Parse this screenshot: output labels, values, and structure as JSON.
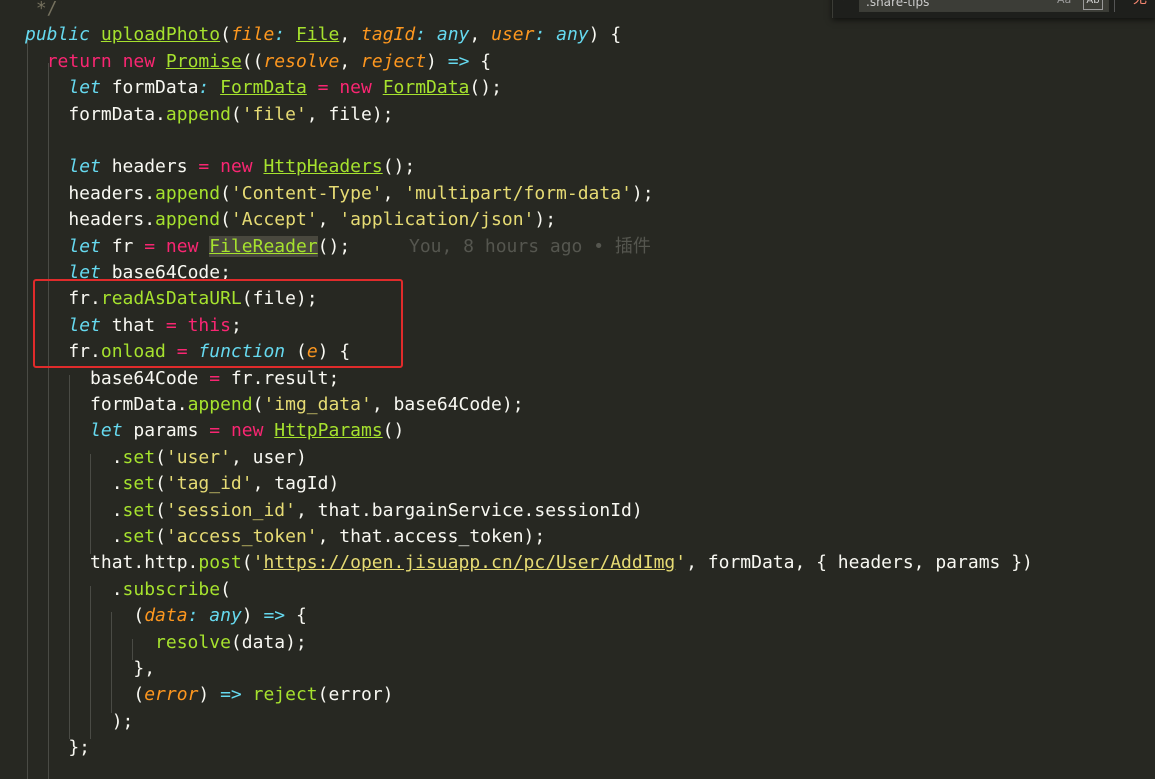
{
  "editor": {
    "lines": [
      [
        {
          "t": "t-comment",
          "v": " */"
        }
      ],
      [
        {
          "t": "t-storage",
          "v": "public",
          "raw": true
        },
        {
          "t": "t-plain",
          "v": " "
        },
        {
          "t": "t-fn-u",
          "v": "uploadPhoto"
        },
        {
          "t": "t-plain",
          "v": "("
        },
        {
          "t": "t-param",
          "v": "file"
        },
        {
          "t": "t-any",
          "v": ":"
        },
        {
          "t": "t-plain",
          "v": " "
        },
        {
          "t": "t-type",
          "v": "File"
        },
        {
          "t": "t-plain",
          "v": ", "
        },
        {
          "t": "t-param",
          "v": "tagId"
        },
        {
          "t": "t-any",
          "v": ":"
        },
        {
          "t": "t-plain",
          "v": " "
        },
        {
          "t": "t-any",
          "v": "any"
        },
        {
          "t": "t-plain",
          "v": ", "
        },
        {
          "t": "t-param",
          "v": "user"
        },
        {
          "t": "t-any",
          "v": ":"
        },
        {
          "t": "t-plain",
          "v": " "
        },
        {
          "t": "t-any",
          "v": "any"
        },
        {
          "t": "t-plain",
          "v": ") {"
        }
      ],
      [
        {
          "t": "t-plain",
          "v": "  "
        },
        {
          "t": "t-kw",
          "v": "return"
        },
        {
          "t": "t-plain",
          "v": " "
        },
        {
          "t": "t-kw",
          "v": "new"
        },
        {
          "t": "t-plain",
          "v": " "
        },
        {
          "t": "t-type",
          "v": "Promise"
        },
        {
          "t": "t-plain",
          "v": "(("
        },
        {
          "t": "t-param",
          "v": "resolve"
        },
        {
          "t": "t-plain",
          "v": ", "
        },
        {
          "t": "t-param",
          "v": "reject"
        },
        {
          "t": "t-plain",
          "v": ") "
        },
        {
          "t": "t-arrow",
          "v": "=>"
        },
        {
          "t": "t-plain",
          "v": " {"
        }
      ],
      [
        {
          "t": "t-plain",
          "v": "    "
        },
        {
          "t": "t-storage",
          "v": "let"
        },
        {
          "t": "t-plain",
          "v": " formData"
        },
        {
          "t": "t-any",
          "v": ":"
        },
        {
          "t": "t-plain",
          "v": " "
        },
        {
          "t": "t-type",
          "v": "FormData"
        },
        {
          "t": "t-plain",
          "v": " "
        },
        {
          "t": "t-op",
          "v": "="
        },
        {
          "t": "t-plain",
          "v": " "
        },
        {
          "t": "t-kw",
          "v": "new"
        },
        {
          "t": "t-plain",
          "v": " "
        },
        {
          "t": "t-type",
          "v": "FormData"
        },
        {
          "t": "t-plain",
          "v": "();"
        }
      ],
      [
        {
          "t": "t-plain",
          "v": "    formData."
        },
        {
          "t": "t-fn",
          "v": "append"
        },
        {
          "t": "t-plain",
          "v": "("
        },
        {
          "t": "t-str",
          "v": "'file'"
        },
        {
          "t": "t-plain",
          "v": ", file);"
        }
      ],
      [
        {
          "t": "t-plain",
          "v": ""
        }
      ],
      [
        {
          "t": "t-plain",
          "v": "    "
        },
        {
          "t": "t-storage",
          "v": "let"
        },
        {
          "t": "t-plain",
          "v": " headers "
        },
        {
          "t": "t-op",
          "v": "="
        },
        {
          "t": "t-plain",
          "v": " "
        },
        {
          "t": "t-kw",
          "v": "new"
        },
        {
          "t": "t-plain",
          "v": " "
        },
        {
          "t": "t-type",
          "v": "HttpHeaders"
        },
        {
          "t": "t-plain",
          "v": "();"
        }
      ],
      [
        {
          "t": "t-plain",
          "v": "    headers."
        },
        {
          "t": "t-fn",
          "v": "append"
        },
        {
          "t": "t-plain",
          "v": "("
        },
        {
          "t": "t-str",
          "v": "'Content-Type'"
        },
        {
          "t": "t-plain",
          "v": ", "
        },
        {
          "t": "t-str",
          "v": "'multipart/form-data'"
        },
        {
          "t": "t-plain",
          "v": ");"
        }
      ],
      [
        {
          "t": "t-plain",
          "v": "    headers."
        },
        {
          "t": "t-fn",
          "v": "append"
        },
        {
          "t": "t-plain",
          "v": "("
        },
        {
          "t": "t-str",
          "v": "'Accept'"
        },
        {
          "t": "t-plain",
          "v": ", "
        },
        {
          "t": "t-str",
          "v": "'application/json'"
        },
        {
          "t": "t-plain",
          "v": ");"
        }
      ],
      [
        {
          "t": "t-plain",
          "v": "    "
        },
        {
          "t": "t-storage",
          "v": "let"
        },
        {
          "t": "t-plain",
          "v": " fr "
        },
        {
          "t": "t-op",
          "v": "="
        },
        {
          "t": "t-plain",
          "v": " "
        },
        {
          "t": "t-kw",
          "v": "new"
        },
        {
          "t": "t-plain",
          "v": " "
        },
        {
          "t": "t-type t-hl",
          "v": "FileReader"
        },
        {
          "t": "t-plain",
          "v": "();"
        }
      ],
      [
        {
          "t": "t-plain",
          "v": "    "
        },
        {
          "t": "t-storage",
          "v": "let"
        },
        {
          "t": "t-plain",
          "v": " base64Code;"
        }
      ],
      [
        {
          "t": "t-plain",
          "v": "    fr."
        },
        {
          "t": "t-fn",
          "v": "readAsDataURL"
        },
        {
          "t": "t-plain",
          "v": "(file);"
        }
      ],
      [
        {
          "t": "t-plain",
          "v": "    "
        },
        {
          "t": "t-storage",
          "v": "let"
        },
        {
          "t": "t-plain",
          "v": " that "
        },
        {
          "t": "t-op",
          "v": "="
        },
        {
          "t": "t-plain",
          "v": " "
        },
        {
          "t": "t-kw",
          "v": "this"
        },
        {
          "t": "t-plain",
          "v": ";"
        }
      ],
      [
        {
          "t": "t-plain",
          "v": "    fr."
        },
        {
          "t": "t-fn",
          "v": "onload"
        },
        {
          "t": "t-plain",
          "v": " "
        },
        {
          "t": "t-op",
          "v": "="
        },
        {
          "t": "t-plain",
          "v": " "
        },
        {
          "t": "t-storage",
          "v": "function"
        },
        {
          "t": "t-plain",
          "v": " ("
        },
        {
          "t": "t-param",
          "v": "e"
        },
        {
          "t": "t-plain",
          "v": ") {"
        }
      ],
      [
        {
          "t": "t-plain",
          "v": "      base64Code "
        },
        {
          "t": "t-op",
          "v": "="
        },
        {
          "t": "t-plain",
          "v": " fr.result;"
        }
      ],
      [
        {
          "t": "t-plain",
          "v": "      formData."
        },
        {
          "t": "t-fn",
          "v": "append"
        },
        {
          "t": "t-plain",
          "v": "("
        },
        {
          "t": "t-str",
          "v": "'img_data'"
        },
        {
          "t": "t-plain",
          "v": ", base64Code);"
        }
      ],
      [
        {
          "t": "t-plain",
          "v": "      "
        },
        {
          "t": "t-storage",
          "v": "let"
        },
        {
          "t": "t-plain",
          "v": " params "
        },
        {
          "t": "t-op",
          "v": "="
        },
        {
          "t": "t-plain",
          "v": " "
        },
        {
          "t": "t-kw",
          "v": "new"
        },
        {
          "t": "t-plain",
          "v": " "
        },
        {
          "t": "t-type",
          "v": "HttpParams"
        },
        {
          "t": "t-plain",
          "v": "()"
        }
      ],
      [
        {
          "t": "t-plain",
          "v": "        ."
        },
        {
          "t": "t-fn",
          "v": "set"
        },
        {
          "t": "t-plain",
          "v": "("
        },
        {
          "t": "t-str",
          "v": "'user'"
        },
        {
          "t": "t-plain",
          "v": ", user)"
        }
      ],
      [
        {
          "t": "t-plain",
          "v": "        ."
        },
        {
          "t": "t-fn",
          "v": "set"
        },
        {
          "t": "t-plain",
          "v": "("
        },
        {
          "t": "t-str",
          "v": "'tag_id'"
        },
        {
          "t": "t-plain",
          "v": ", tagId)"
        }
      ],
      [
        {
          "t": "t-plain",
          "v": "        ."
        },
        {
          "t": "t-fn",
          "v": "set"
        },
        {
          "t": "t-plain",
          "v": "("
        },
        {
          "t": "t-str",
          "v": "'session_id'"
        },
        {
          "t": "t-plain",
          "v": ", that.bargainService.sessionId)"
        }
      ],
      [
        {
          "t": "t-plain",
          "v": "        ."
        },
        {
          "t": "t-fn",
          "v": "set"
        },
        {
          "t": "t-plain",
          "v": "("
        },
        {
          "t": "t-str",
          "v": "'access_token'"
        },
        {
          "t": "t-plain",
          "v": ", that.access_token);"
        }
      ],
      [
        {
          "t": "t-plain",
          "v": "      that.http."
        },
        {
          "t": "t-fn",
          "v": "post"
        },
        {
          "t": "t-plain",
          "v": "("
        },
        {
          "t": "t-str",
          "v": "'"
        },
        {
          "t": "t-str-u",
          "v": "https://open.jisuapp.cn/pc/User/AddImg"
        },
        {
          "t": "t-str",
          "v": "'"
        },
        {
          "t": "t-plain",
          "v": ", formData, { headers, params })"
        }
      ],
      [
        {
          "t": "t-plain",
          "v": "        ."
        },
        {
          "t": "t-fn",
          "v": "subscribe"
        },
        {
          "t": "t-plain",
          "v": "("
        }
      ],
      [
        {
          "t": "t-plain",
          "v": "          ("
        },
        {
          "t": "t-param",
          "v": "data"
        },
        {
          "t": "t-any",
          "v": ":"
        },
        {
          "t": "t-plain",
          "v": " "
        },
        {
          "t": "t-any",
          "v": "any"
        },
        {
          "t": "t-plain",
          "v": ") "
        },
        {
          "t": "t-arrow",
          "v": "=>"
        },
        {
          "t": "t-plain",
          "v": " {"
        }
      ],
      [
        {
          "t": "t-plain",
          "v": "            "
        },
        {
          "t": "t-fn",
          "v": "resolve"
        },
        {
          "t": "t-plain",
          "v": "(data);"
        }
      ],
      [
        {
          "t": "t-plain",
          "v": "          },"
        }
      ],
      [
        {
          "t": "t-plain",
          "v": "          ("
        },
        {
          "t": "t-param",
          "v": "error"
        },
        {
          "t": "t-plain",
          "v": ") "
        },
        {
          "t": "t-arrow",
          "v": "=>"
        },
        {
          "t": "t-plain",
          "v": " "
        },
        {
          "t": "t-fn",
          "v": "reject"
        },
        {
          "t": "t-plain",
          "v": "(error)"
        }
      ],
      [
        {
          "t": "t-plain",
          "v": "        );"
        }
      ],
      [
        {
          "t": "t-plain",
          "v": "    };"
        }
      ]
    ],
    "blame_annotation": "You, 8 hours ago • 插件"
  },
  "find_widget": {
    "query": ".share-tips",
    "match_case_label": "Aa",
    "whole_word_label": "Ab",
    "result_text": "无"
  },
  "colors": {
    "background": "#272822",
    "highlight_box": "#e02b2b"
  }
}
